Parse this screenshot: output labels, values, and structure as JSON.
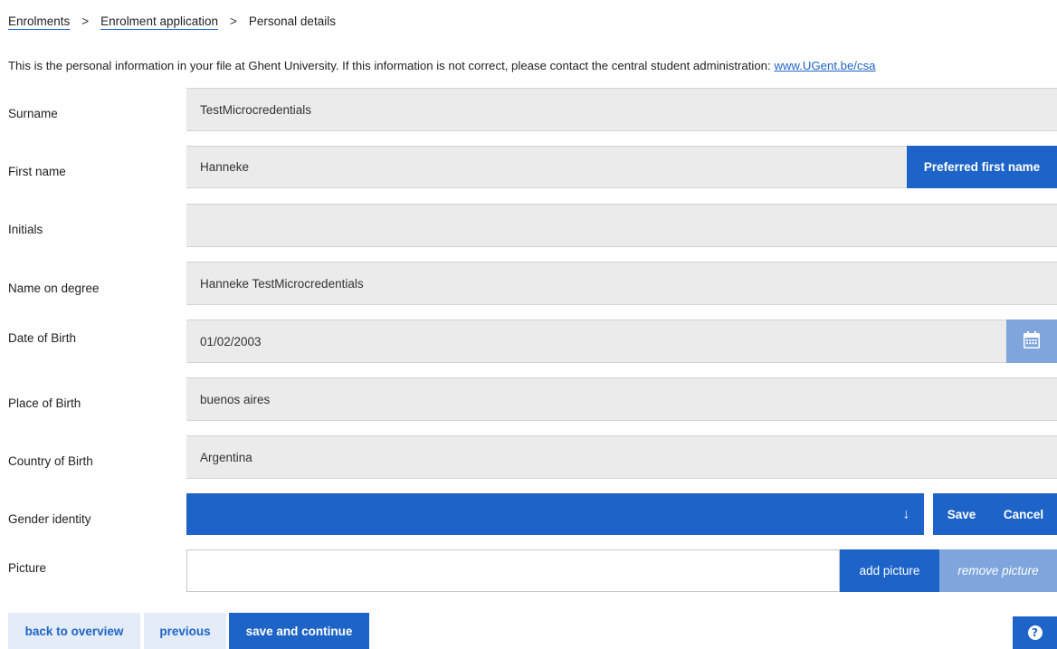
{
  "breadcrumb": {
    "items": [
      "Enrolments",
      "Enrolment application"
    ],
    "separator": ">",
    "current": "Personal details"
  },
  "intro": {
    "text": "This is the personal information in your file at Ghent University. If this information is not correct, please contact the central student administration: ",
    "link": "www.UGent.be/csa"
  },
  "fields": {
    "surname": {
      "label": "Surname",
      "value": "TestMicrocredentials"
    },
    "first_name": {
      "label": "First name",
      "value": "Hanneke",
      "button": "Preferred first name"
    },
    "initials": {
      "label": "Initials",
      "value": ""
    },
    "name_on_degree": {
      "label": "Name on degree",
      "value": "Hanneke TestMicrocredentials"
    },
    "date_of_birth": {
      "label": "Date of Birth",
      "value": "01/02/2003",
      "icon": "calendar-icon"
    },
    "place_of_birth": {
      "label": "Place of Birth",
      "value": "buenos aires"
    },
    "country_of_birth": {
      "label": "Country of Birth",
      "value": "Argentina"
    },
    "gender_identity": {
      "label": "Gender identity",
      "value": "",
      "arrow": "↓",
      "save": "Save",
      "cancel": "Cancel"
    },
    "picture": {
      "label": "Picture",
      "add": "add picture",
      "remove": "remove picture"
    }
  },
  "actions": {
    "back": "back to overview",
    "previous": "previous",
    "save_continue": "save and continue",
    "help_glyph": "?",
    "help_icon": "help-icon"
  },
  "colors": {
    "accent": "#1e64c8",
    "accent_light": "#7ea6dc",
    "field_bg": "#ebebeb",
    "pale_button": "#e3ecf8"
  }
}
